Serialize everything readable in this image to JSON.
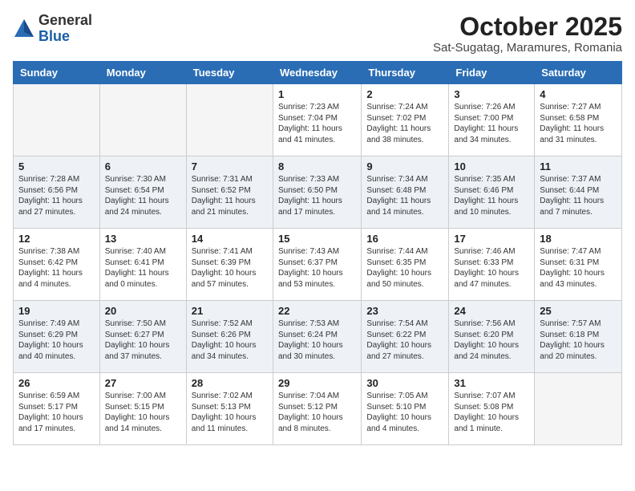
{
  "header": {
    "logo_general": "General",
    "logo_blue": "Blue",
    "title": "October 2025",
    "subtitle": "Sat-Sugatag, Maramures, Romania"
  },
  "weekdays": [
    "Sunday",
    "Monday",
    "Tuesday",
    "Wednesday",
    "Thursday",
    "Friday",
    "Saturday"
  ],
  "weeks": [
    [
      {
        "day": "",
        "info": ""
      },
      {
        "day": "",
        "info": ""
      },
      {
        "day": "",
        "info": ""
      },
      {
        "day": "1",
        "info": "Sunrise: 7:23 AM\nSunset: 7:04 PM\nDaylight: 11 hours\nand 41 minutes."
      },
      {
        "day": "2",
        "info": "Sunrise: 7:24 AM\nSunset: 7:02 PM\nDaylight: 11 hours\nand 38 minutes."
      },
      {
        "day": "3",
        "info": "Sunrise: 7:26 AM\nSunset: 7:00 PM\nDaylight: 11 hours\nand 34 minutes."
      },
      {
        "day": "4",
        "info": "Sunrise: 7:27 AM\nSunset: 6:58 PM\nDaylight: 11 hours\nand 31 minutes."
      }
    ],
    [
      {
        "day": "5",
        "info": "Sunrise: 7:28 AM\nSunset: 6:56 PM\nDaylight: 11 hours\nand 27 minutes."
      },
      {
        "day": "6",
        "info": "Sunrise: 7:30 AM\nSunset: 6:54 PM\nDaylight: 11 hours\nand 24 minutes."
      },
      {
        "day": "7",
        "info": "Sunrise: 7:31 AM\nSunset: 6:52 PM\nDaylight: 11 hours\nand 21 minutes."
      },
      {
        "day": "8",
        "info": "Sunrise: 7:33 AM\nSunset: 6:50 PM\nDaylight: 11 hours\nand 17 minutes."
      },
      {
        "day": "9",
        "info": "Sunrise: 7:34 AM\nSunset: 6:48 PM\nDaylight: 11 hours\nand 14 minutes."
      },
      {
        "day": "10",
        "info": "Sunrise: 7:35 AM\nSunset: 6:46 PM\nDaylight: 11 hours\nand 10 minutes."
      },
      {
        "day": "11",
        "info": "Sunrise: 7:37 AM\nSunset: 6:44 PM\nDaylight: 11 hours\nand 7 minutes."
      }
    ],
    [
      {
        "day": "12",
        "info": "Sunrise: 7:38 AM\nSunset: 6:42 PM\nDaylight: 11 hours\nand 4 minutes."
      },
      {
        "day": "13",
        "info": "Sunrise: 7:40 AM\nSunset: 6:41 PM\nDaylight: 11 hours\nand 0 minutes."
      },
      {
        "day": "14",
        "info": "Sunrise: 7:41 AM\nSunset: 6:39 PM\nDaylight: 10 hours\nand 57 minutes."
      },
      {
        "day": "15",
        "info": "Sunrise: 7:43 AM\nSunset: 6:37 PM\nDaylight: 10 hours\nand 53 minutes."
      },
      {
        "day": "16",
        "info": "Sunrise: 7:44 AM\nSunset: 6:35 PM\nDaylight: 10 hours\nand 50 minutes."
      },
      {
        "day": "17",
        "info": "Sunrise: 7:46 AM\nSunset: 6:33 PM\nDaylight: 10 hours\nand 47 minutes."
      },
      {
        "day": "18",
        "info": "Sunrise: 7:47 AM\nSunset: 6:31 PM\nDaylight: 10 hours\nand 43 minutes."
      }
    ],
    [
      {
        "day": "19",
        "info": "Sunrise: 7:49 AM\nSunset: 6:29 PM\nDaylight: 10 hours\nand 40 minutes."
      },
      {
        "day": "20",
        "info": "Sunrise: 7:50 AM\nSunset: 6:27 PM\nDaylight: 10 hours\nand 37 minutes."
      },
      {
        "day": "21",
        "info": "Sunrise: 7:52 AM\nSunset: 6:26 PM\nDaylight: 10 hours\nand 34 minutes."
      },
      {
        "day": "22",
        "info": "Sunrise: 7:53 AM\nSunset: 6:24 PM\nDaylight: 10 hours\nand 30 minutes."
      },
      {
        "day": "23",
        "info": "Sunrise: 7:54 AM\nSunset: 6:22 PM\nDaylight: 10 hours\nand 27 minutes."
      },
      {
        "day": "24",
        "info": "Sunrise: 7:56 AM\nSunset: 6:20 PM\nDaylight: 10 hours\nand 24 minutes."
      },
      {
        "day": "25",
        "info": "Sunrise: 7:57 AM\nSunset: 6:18 PM\nDaylight: 10 hours\nand 20 minutes."
      }
    ],
    [
      {
        "day": "26",
        "info": "Sunrise: 6:59 AM\nSunset: 5:17 PM\nDaylight: 10 hours\nand 17 minutes."
      },
      {
        "day": "27",
        "info": "Sunrise: 7:00 AM\nSunset: 5:15 PM\nDaylight: 10 hours\nand 14 minutes."
      },
      {
        "day": "28",
        "info": "Sunrise: 7:02 AM\nSunset: 5:13 PM\nDaylight: 10 hours\nand 11 minutes."
      },
      {
        "day": "29",
        "info": "Sunrise: 7:04 AM\nSunset: 5:12 PM\nDaylight: 10 hours\nand 8 minutes."
      },
      {
        "day": "30",
        "info": "Sunrise: 7:05 AM\nSunset: 5:10 PM\nDaylight: 10 hours\nand 4 minutes."
      },
      {
        "day": "31",
        "info": "Sunrise: 7:07 AM\nSunset: 5:08 PM\nDaylight: 10 hours\nand 1 minute."
      },
      {
        "day": "",
        "info": ""
      }
    ]
  ]
}
